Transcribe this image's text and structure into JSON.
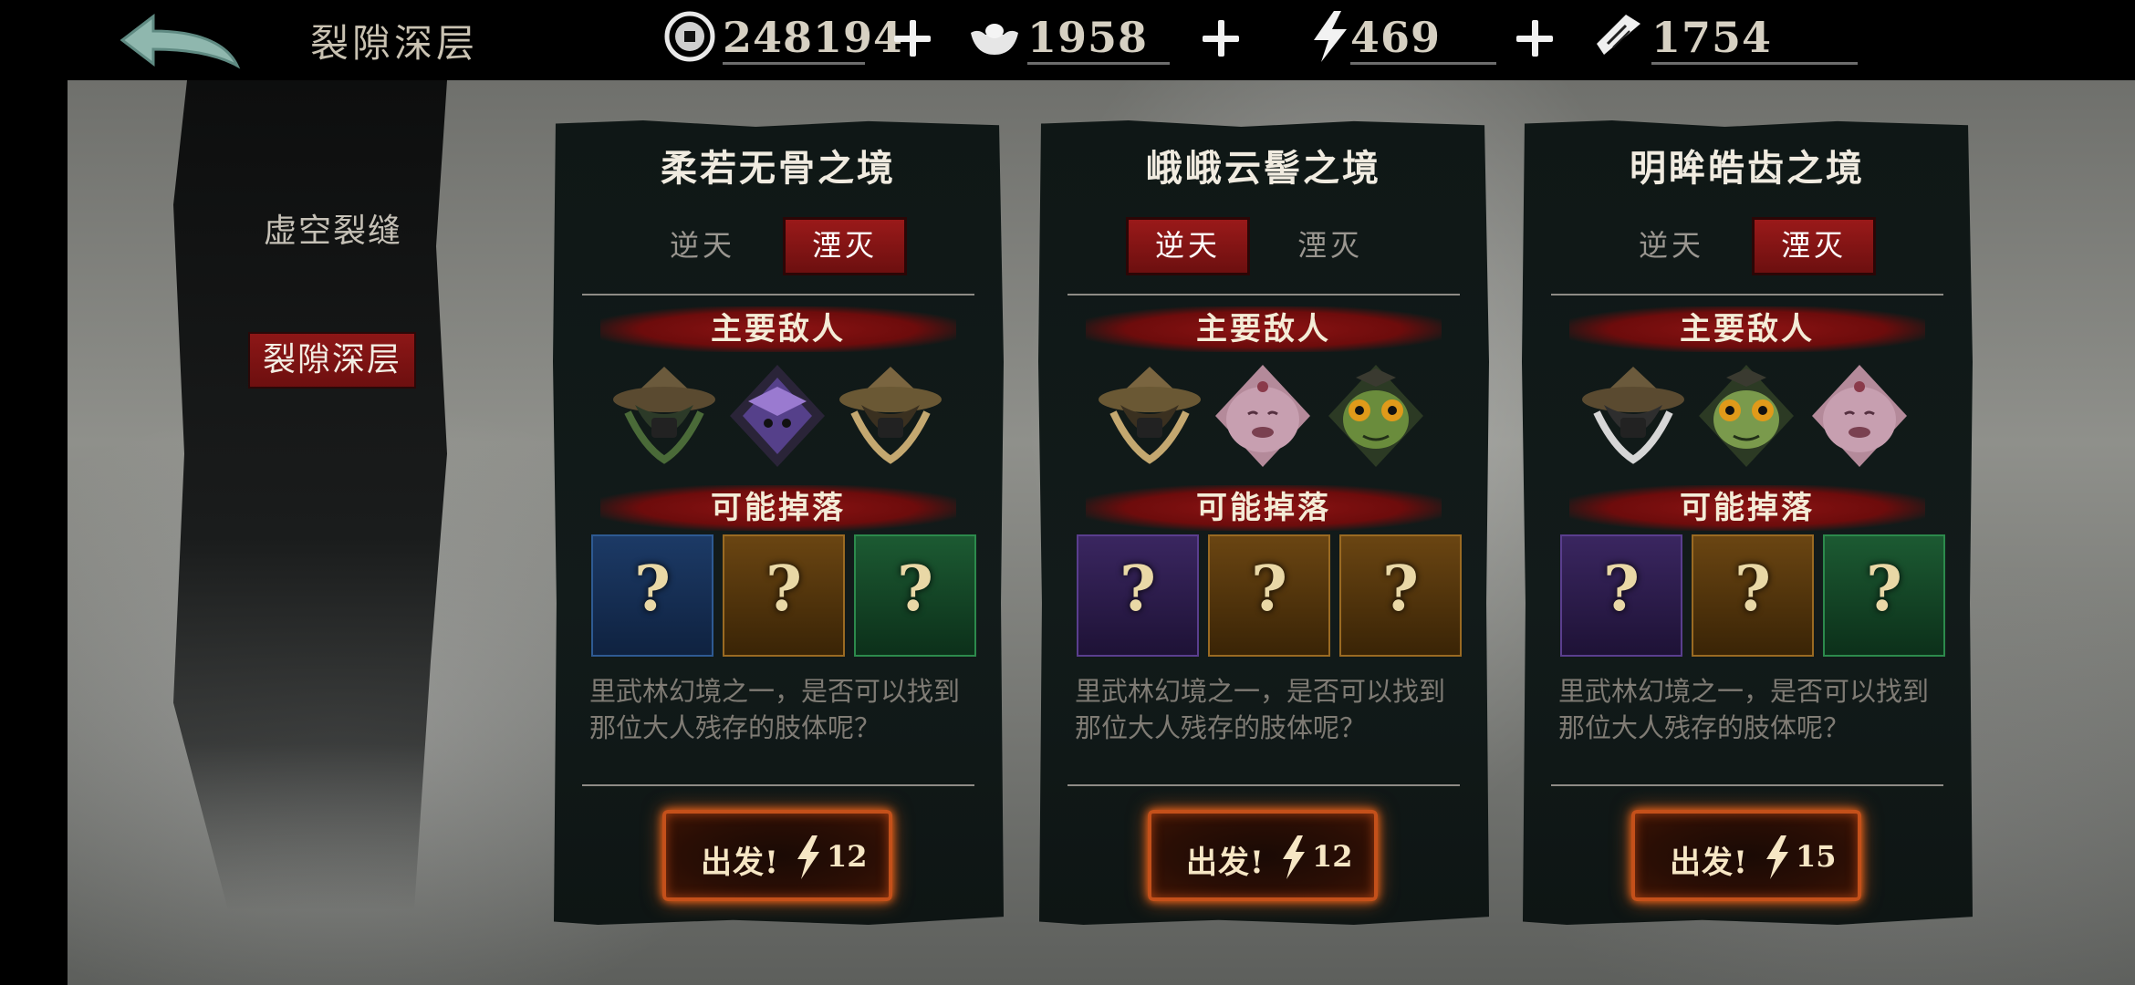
{
  "header": {
    "title": "裂隙深层",
    "resources": [
      {
        "icon": "coin-icon",
        "value": "248194"
      },
      {
        "icon": "silver-ingot-icon",
        "value": "1958"
      },
      {
        "icon": "lightning-icon",
        "value": "469"
      },
      {
        "icon": "ticket-icon",
        "value": "1754"
      }
    ]
  },
  "sidebar": {
    "items": [
      {
        "label": "虚空裂缝",
        "selected": false
      },
      {
        "label": "裂隙深层",
        "selected": true
      }
    ]
  },
  "cards": [
    {
      "title": "柔若无骨之境",
      "difficulty": [
        "逆天",
        "湮灭"
      ],
      "difficulty_selected": 1,
      "enemies_label": "主要敌人",
      "enemies": [
        "straw-hat-monk-icon",
        "dark-crystal-demon-icon",
        "straw-hat-monk-icon"
      ],
      "drops_label": "可能掉落",
      "drops": [
        {
          "rarity": "blue",
          "mark": "?"
        },
        {
          "rarity": "gold",
          "mark": "?"
        },
        {
          "rarity": "green",
          "mark": "?"
        }
      ],
      "description": "里武林幻境之一，是否可以找到那位大人残存的肢体呢？",
      "button": {
        "label": "出发!",
        "cost": "12"
      }
    },
    {
      "title": "峨峨云髻之境",
      "difficulty": [
        "逆天",
        "湮灭"
      ],
      "difficulty_selected": 0,
      "enemies_label": "主要敌人",
      "enemies": [
        "straw-hat-monk-icon",
        "pink-blob-monster-icon",
        "frog-warrior-icon"
      ],
      "drops_label": "可能掉落",
      "drops": [
        {
          "rarity": "purple",
          "mark": "?"
        },
        {
          "rarity": "gold",
          "mark": "?"
        },
        {
          "rarity": "gold",
          "mark": "?"
        }
      ],
      "description": "里武林幻境之一，是否可以找到那位大人残存的肢体呢？",
      "button": {
        "label": "出发!",
        "cost": "12"
      }
    },
    {
      "title": "明眸皓齿之境",
      "difficulty": [
        "逆天",
        "湮灭"
      ],
      "difficulty_selected": 1,
      "enemies_label": "主要敌人",
      "enemies": [
        "straw-hat-monk-icon",
        "frog-warrior-icon",
        "pink-blob-monster-icon"
      ],
      "drops_label": "可能掉落",
      "drops": [
        {
          "rarity": "purple",
          "mark": "?"
        },
        {
          "rarity": "gold",
          "mark": "?"
        },
        {
          "rarity": "green",
          "mark": "?"
        }
      ],
      "description": "里武林幻境之一，是否可以找到那位大人残存的肢体呢？",
      "button": {
        "label": "出发!",
        "cost": "15"
      }
    }
  ],
  "colors": {
    "accent_red": "#8e1717",
    "button_glow": "#ff6a1a",
    "drop_blue": "#1c3a66",
    "drop_gold": "#6a4512",
    "drop_green": "#1c5a32",
    "drop_purple": "#3a2660"
  }
}
